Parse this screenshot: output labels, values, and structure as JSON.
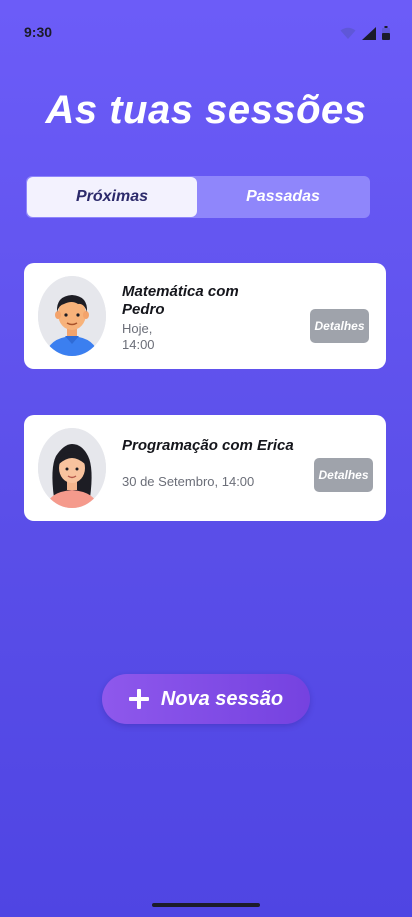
{
  "status_bar": {
    "time": "9:30"
  },
  "title": "As tuas sessões",
  "tabs": [
    {
      "label": "Próximas",
      "active": true
    },
    {
      "label": "Passadas",
      "active": false
    }
  ],
  "sessions": [
    {
      "title": "Matemática com Pedro",
      "time": "Hoje, 14:00",
      "button": "Detalhes",
      "avatar": "boy-avatar"
    },
    {
      "title": "Programação com Erica",
      "time": "30 de Setembro, 14:00",
      "button": "Detalhes",
      "avatar": "girl-avatar"
    }
  ],
  "new_session_button": {
    "label": "Nova sessão",
    "icon": "plus-icon"
  },
  "colors": {
    "background_top": "#6c5cf8",
    "background_bottom": "#4f45e3",
    "tab_active_bg": "#f3f2fe",
    "tab_inactive_bg": "#8f86fb",
    "details_button": "#9fa3ab",
    "new_session_button": "#7f4ce6"
  }
}
